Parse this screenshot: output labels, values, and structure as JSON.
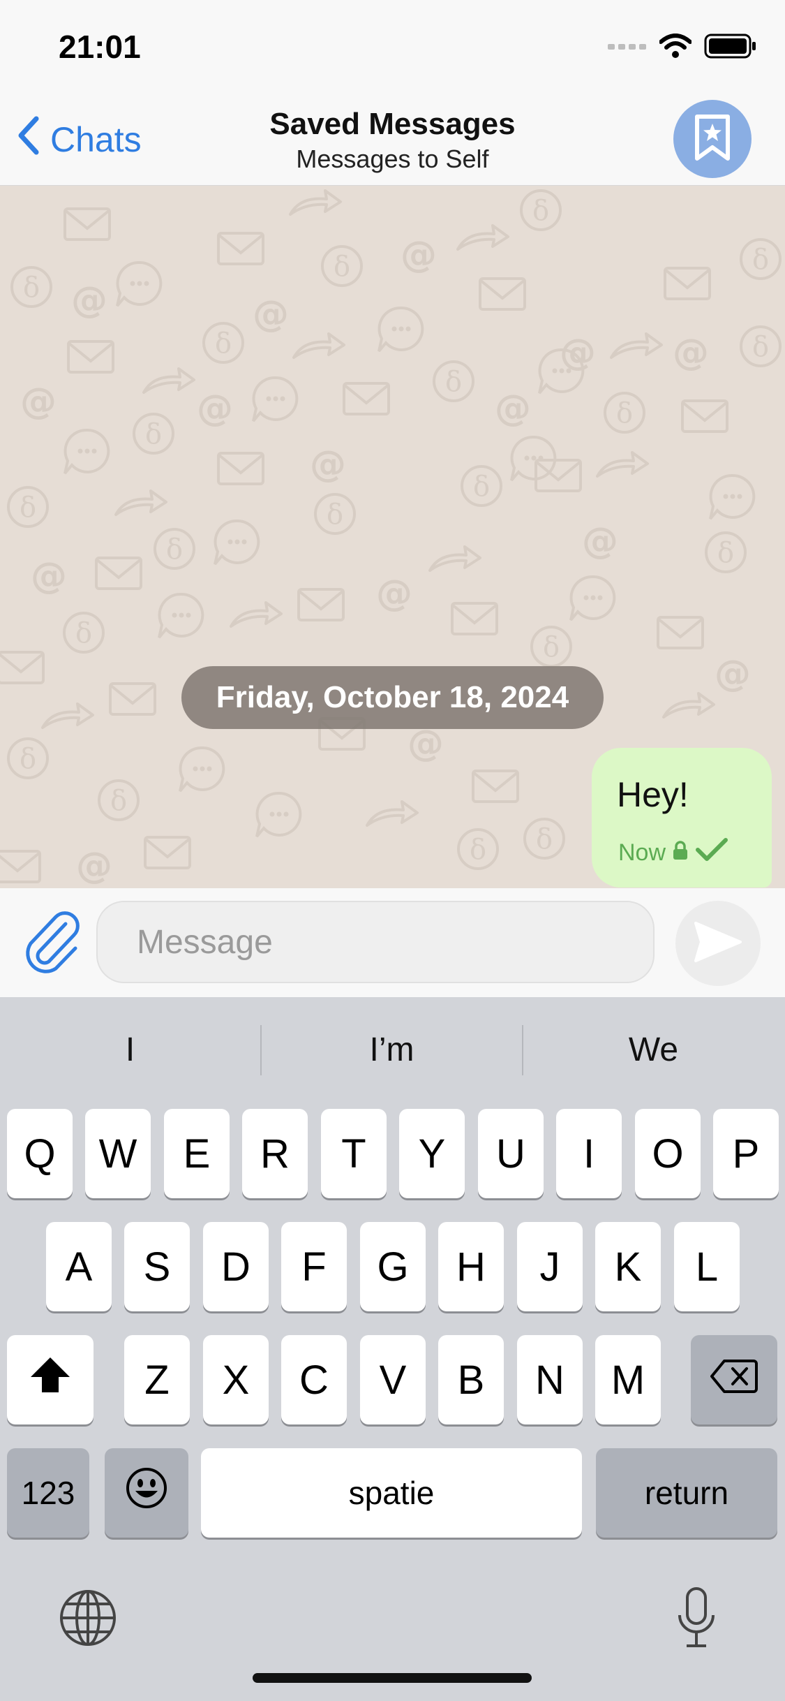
{
  "status": {
    "time": "21:01"
  },
  "nav": {
    "back_label": "Chats",
    "title": "Saved Messages",
    "subtitle": "Messages to Self"
  },
  "chat": {
    "date_label": "Friday, October 18, 2024",
    "message": {
      "text": "Hey!",
      "time": "Now"
    }
  },
  "composer": {
    "placeholder": "Message"
  },
  "keyboard": {
    "suggestions": [
      "I",
      "I’m",
      "We"
    ],
    "row1": [
      "Q",
      "W",
      "E",
      "R",
      "T",
      "Y",
      "U",
      "I",
      "O",
      "P"
    ],
    "row2": [
      "A",
      "S",
      "D",
      "F",
      "G",
      "H",
      "J",
      "K",
      "L"
    ],
    "row3": [
      "Z",
      "X",
      "C",
      "V",
      "B",
      "N",
      "M"
    ],
    "numbers_label": "123",
    "space_label": "spatie",
    "return_label": "return"
  },
  "colors": {
    "accent": "#2f7de1",
    "bubble": "#dcf8c6",
    "wallpaper": "#e6ddd5",
    "avatar": "#8aaee3"
  }
}
